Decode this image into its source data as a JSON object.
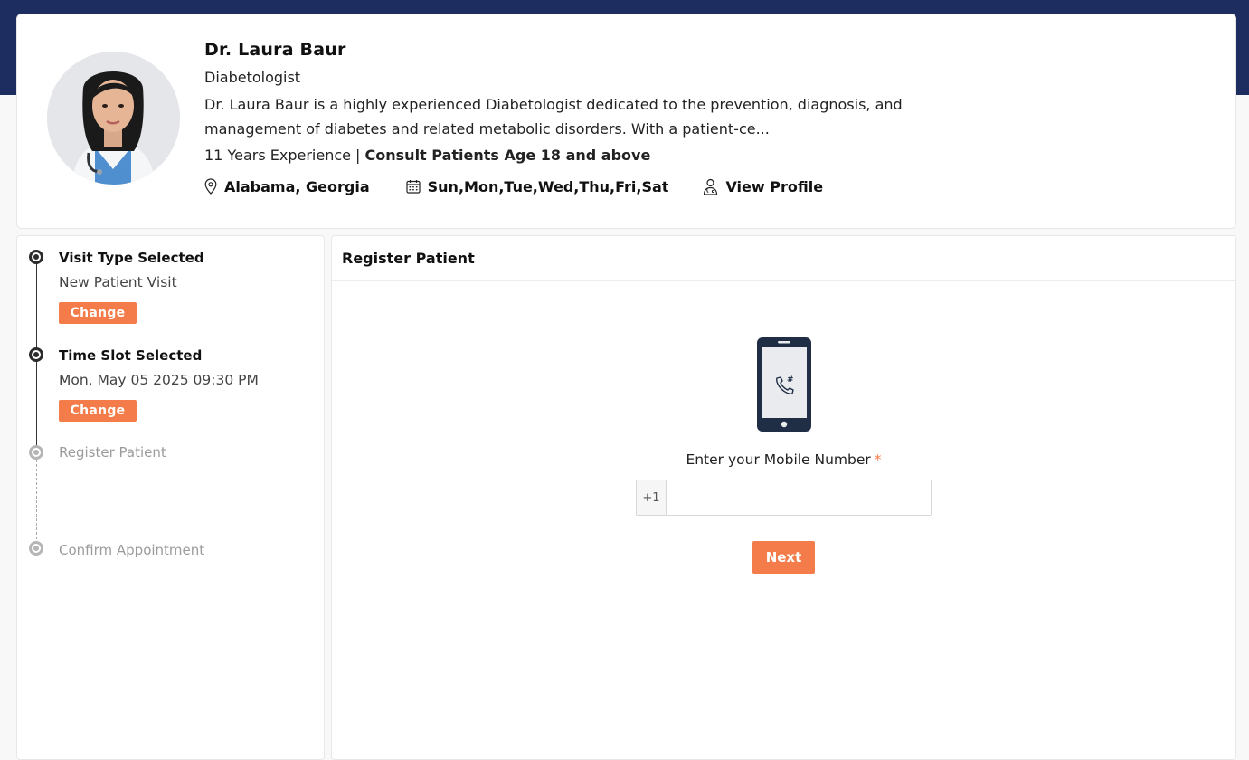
{
  "doctor": {
    "name": "Dr. Laura Baur",
    "specialty": "Diabetologist",
    "bio": "Dr. Laura Baur is a highly experienced Diabetologist dedicated to the prevention, diagnosis, and management of diabetes and related metabolic disorders. With a patient-ce...",
    "experience": "11 Years Experience | ",
    "age_policy": "Consult Patients Age 18 and above",
    "location": "Alabama, Georgia",
    "days": "Sun,Mon,Tue,Wed,Thu,Fri,Sat",
    "view_profile": "View Profile",
    "icons": {
      "location": "map-pin-icon",
      "days": "calendar-icon",
      "profile": "doctor-icon"
    }
  },
  "steps": [
    {
      "title": "Visit Type Selected",
      "value": "New Patient Visit",
      "action": "Change",
      "status": "done"
    },
    {
      "title": "Time Slot Selected",
      "value": "Mon, May 05 2025 09:30 PM",
      "action": "Change",
      "status": "done"
    },
    {
      "title": "Register Patient",
      "status": "pending"
    },
    {
      "title": "Confirm Appointment",
      "status": "pending"
    }
  ],
  "register": {
    "title": "Register Patient",
    "mobile_label": "Enter your Mobile Number",
    "required_mark": "*",
    "country_code": "+1",
    "mobile_value": "",
    "next_label": "Next",
    "icon": "mobile-phone-icon"
  },
  "colors": {
    "header_band": "#1e2d5f",
    "accent": "#f47c4a"
  }
}
